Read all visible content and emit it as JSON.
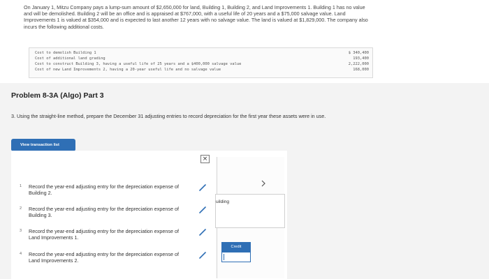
{
  "intro": {
    "text": "On January 1, Mitzu Company pays a lump-sum amount of $2,650,000 for land, Building 1, Building 2, and Land Improvements 1. Building 1 has no value and will be demolished. Building 2 will be an office and is appraised at $767,000, with a useful life of 20 years and a $75,000 salvage value. Land Improvements 1 is valued at $354,000 and is expected to last another 12 years with no salvage value. The land is valued at $1,829,000. The company also incurs the following additional costs."
  },
  "costs": [
    {
      "label": "Cost to demolish Building 1",
      "amount": "$ 340,400"
    },
    {
      "label": "Cost of additional land grading",
      "amount": "193,400"
    },
    {
      "label": "Cost to construct Building 3, having a useful life of 25 years and a $400,000 salvage value",
      "amount": "2,222,000"
    },
    {
      "label": "Cost of new Land Improvements 2, having a 20-year useful life and no salvage value",
      "amount": "168,000"
    }
  ],
  "problem": {
    "title": "Problem 8-3A (Algo) Part 3",
    "question": "3. Using the straight-line method, prepare the December 31 adjusting entries to record depreciation for the first year these assets were in use."
  },
  "toolbar": {
    "view_transaction_list": "View transaction list",
    "close_glyph": "×"
  },
  "steps": [
    {
      "num": "1",
      "text": "Record the year-end adjusting entry for the depreciation expense of Building 2."
    },
    {
      "num": "2",
      "text": "Record the year-end adjusting entry for the depreciation expense of Building 3."
    },
    {
      "num": "3",
      "text": "Record the year-end adjusting entry for the depreciation expense of Land Improvements 1."
    },
    {
      "num": "4",
      "text": "Record the year-end adjusting entry for the depreciation expense of Land Improvements 2."
    }
  ],
  "journal": {
    "account_partial": "uilding",
    "credit_header": "Credit"
  },
  "icons": {
    "edit": "pencil-icon",
    "next": "chevron-right-icon",
    "close": "close-icon"
  },
  "colors": {
    "accent": "#2f6fb5"
  }
}
